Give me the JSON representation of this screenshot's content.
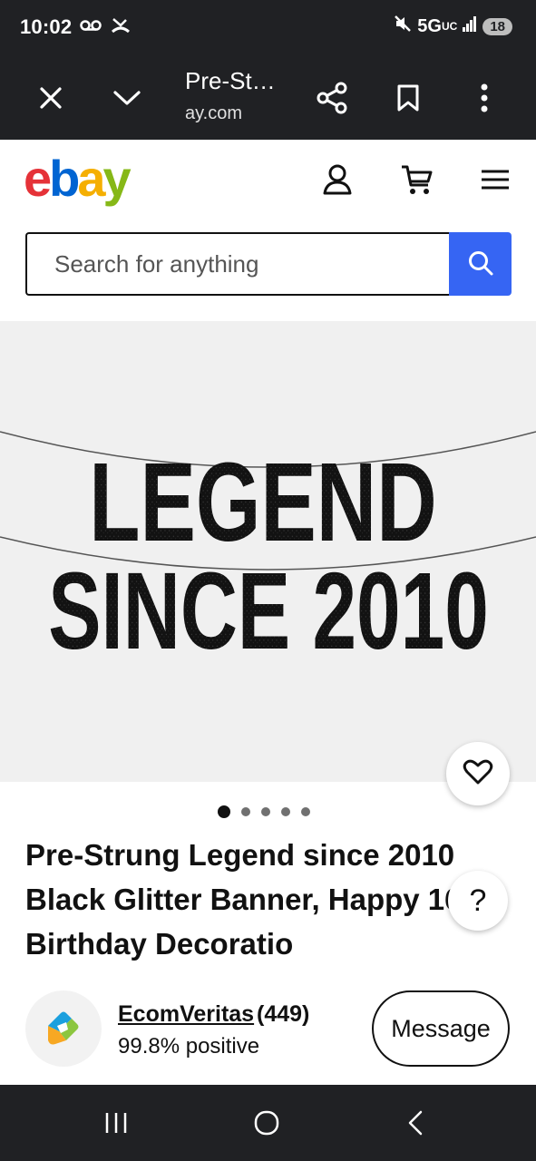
{
  "status_bar": {
    "time": "10:02",
    "network": "5G",
    "network_sub": "UC",
    "battery": "18"
  },
  "browser": {
    "title": "Pre-St…",
    "url": "ay.com"
  },
  "header": {
    "logo_e": "e",
    "logo_b": "b",
    "logo_a": "a",
    "logo_y": "y"
  },
  "search": {
    "placeholder": "Search for anything"
  },
  "product": {
    "banner_line1": "LEGEND",
    "banner_line2": "SINCE 2010",
    "image_count": 5,
    "active_image": 1,
    "title": "Pre-Strung Legend since 2010 Black Glitter Banner, Happy 16Th Birthday Decoratio",
    "help_label": "?"
  },
  "seller": {
    "name": "EcomVeritas",
    "feedback_count": "(449)",
    "rating": "99.8% positive",
    "message_label": "Message"
  },
  "colors": {
    "ebay_red": "#e53238",
    "ebay_blue": "#0064d2",
    "ebay_yellow": "#f5af02",
    "ebay_green": "#86b817",
    "search_button": "#3665f3"
  }
}
